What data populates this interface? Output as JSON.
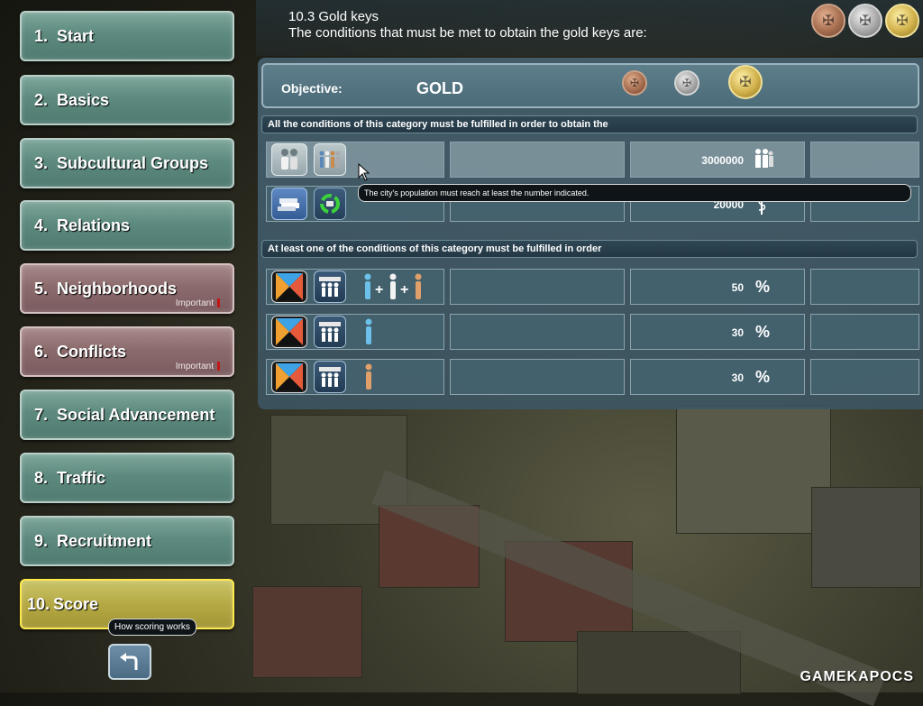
{
  "nav": {
    "items": [
      {
        "num": "1.",
        "label": "Start"
      },
      {
        "num": "2.",
        "label": "Basics"
      },
      {
        "num": "3.",
        "label": "Subcultural Groups"
      },
      {
        "num": "4.",
        "label": "Relations"
      },
      {
        "num": "5.",
        "label": "Neighborhoods",
        "tag": "Important"
      },
      {
        "num": "6.",
        "label": "Conflicts",
        "tag": "Important"
      },
      {
        "num": "7.",
        "label": "Social Advancement"
      },
      {
        "num": "8.",
        "label": "Traffic"
      },
      {
        "num": "9.",
        "label": "Recruitment"
      },
      {
        "num": "10.",
        "label": "Score"
      }
    ],
    "active_index": 9,
    "score_tooltip": "How scoring works"
  },
  "header": {
    "title": "10.3  Gold keys",
    "subtitle": "The conditions that must be met to obtain the gold keys are:"
  },
  "objective": {
    "label": "Objective:",
    "value": "GOLD"
  },
  "categories": [
    {
      "header": "All the conditions of this category must be fulfilled in order to obtain the",
      "rows": [
        {
          "value": "3000000",
          "unit_icon": "people-icon"
        },
        {
          "value": "20000",
          "unit_icon": "money-icon"
        }
      ]
    },
    {
      "header": "At least one of the conditions of this category must be fulfilled in order",
      "rows": [
        {
          "value": "50",
          "unit": "%"
        },
        {
          "value": "30",
          "unit": "%"
        },
        {
          "value": "30",
          "unit": "%"
        }
      ]
    }
  ],
  "tooltip_population": "The city's population must reach at least the number indicated.",
  "watermark": "GAMEKAPOCS",
  "colors": {
    "nav_normal": "#5d8a7f",
    "nav_important": "#8c6b6d",
    "nav_active": "#b5a944",
    "panel": "#45606e"
  }
}
